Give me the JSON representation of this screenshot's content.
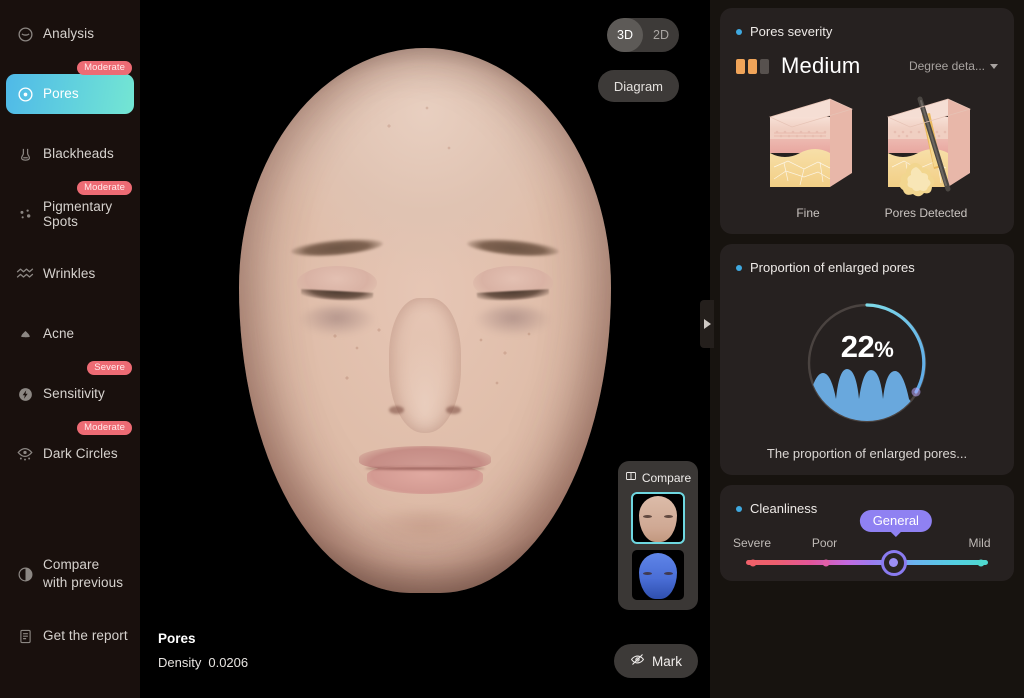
{
  "sidebar": {
    "items": [
      {
        "label": "Analysis",
        "icon": "analysis-icon",
        "badge": null,
        "active": false
      },
      {
        "label": "Pores",
        "icon": "pores-icon",
        "badge": "Moderate",
        "active": true
      },
      {
        "label": "Blackheads",
        "icon": "blackheads-icon",
        "badge": null,
        "active": false
      },
      {
        "label": "Pigmentary Spots",
        "icon": "pigmentary-spots-icon",
        "badge": "Moderate",
        "active": false
      },
      {
        "label": "Wrinkles",
        "icon": "wrinkles-icon",
        "badge": null,
        "active": false
      },
      {
        "label": "Acne",
        "icon": "acne-icon",
        "badge": null,
        "active": false
      },
      {
        "label": "Sensitivity",
        "icon": "sensitivity-icon",
        "badge": "Severe",
        "active": false
      },
      {
        "label": "Dark Circles",
        "icon": "dark-circles-icon",
        "badge": "Moderate",
        "active": false
      }
    ],
    "footer": [
      {
        "label": "Compare\nwith previous",
        "line1": "Compare",
        "line2": "with previous",
        "icon": "contrast-icon"
      },
      {
        "label": "Get the report",
        "icon": "report-icon"
      }
    ],
    "active_gradient_from": "#4fb9e8",
    "active_gradient_to": "#74e6d3",
    "badge_color": "#ed6b74"
  },
  "viewer": {
    "view_modes": [
      {
        "label": "3D",
        "selected": true
      },
      {
        "label": "2D",
        "selected": false
      }
    ],
    "diagram_button": "Diagram",
    "caption_title": "Pores",
    "caption_metric_label": "Density",
    "caption_metric_value": "0.0206",
    "compare": {
      "title": "Compare",
      "thumbnails": [
        {
          "name": "rgb-thumbnail",
          "selected": true
        },
        {
          "name": "uv-thumbnail",
          "selected": false
        }
      ]
    },
    "mark_button": "Mark",
    "collapse_handle": "collapse-panel-handle"
  },
  "panels": {
    "severity": {
      "title": "Pores severity",
      "level_word": "Medium",
      "bars_filled": 2,
      "bars_total": 3,
      "bar_on_color": "#f0a459",
      "bar_off_color": "#57514e",
      "degree_details_label": "Degree deta...",
      "illustrations": [
        {
          "caption": "Fine",
          "name": "fine-skin-diagram"
        },
        {
          "caption": "Pores Detected",
          "name": "pores-detected-skin-diagram"
        }
      ]
    },
    "proportion": {
      "title": "Proportion of enlarged pores",
      "value": "22",
      "percent_symbol": "%",
      "value_number": 22,
      "arc_color_from": "#6fd9e6",
      "arc_color_to": "#8b7df0",
      "track_color": "#4a4340",
      "description": "The proportion of enlarged pores..."
    },
    "cleanliness": {
      "title": "Cleanliness",
      "scale": [
        "Severe",
        "Poor",
        "General",
        "Mild"
      ],
      "selected": "General",
      "selected_index": 2,
      "gradient_from": "#f0606a",
      "gradient_to": "#4fd9cf",
      "knob_color": "#8a7bf0"
    }
  }
}
